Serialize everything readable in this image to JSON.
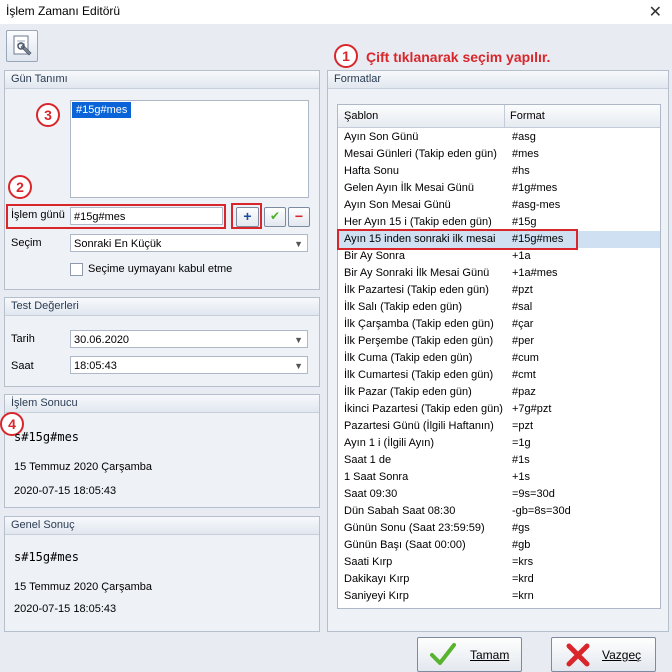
{
  "window": {
    "title": "İşlem Zamanı Editörü",
    "close_glyph": "✕"
  },
  "annotations": {
    "n1": "1",
    "n2": "2",
    "n3": "3",
    "n4": "4",
    "instruction": "Çift tıklanarak seçim yapılır."
  },
  "gun_tanimi": {
    "header": "Gün Tanımı",
    "list_items": [
      "#15g#mes"
    ],
    "islem_gunu_label": "İşlem günü",
    "islem_gunu_value": "#15g#mes",
    "secim_label": "Seçim",
    "secim_value": "Sonraki En Küçük",
    "checkbox_label": "Seçime uymayanı kabul etme",
    "add_glyph": "+",
    "apply_glyph": "✔",
    "remove_glyph": "−"
  },
  "test_degerleri": {
    "header": "Test Değerleri",
    "tarih_label": "Tarih",
    "tarih_value": "30.06.2020",
    "saat_label": "Saat",
    "saat_value": "18:05:43"
  },
  "islem_sonucu": {
    "header": "İşlem Sonucu",
    "expr": "s#15g#mes",
    "date_text": "15 Temmuz 2020 Çarşamba",
    "datetime": "2020-07-15 18:05:43"
  },
  "genel_sonuc": {
    "header": "Genel Sonuç",
    "expr": "s#15g#mes",
    "date_text": "15 Temmuz 2020 Çarşamba",
    "datetime": "2020-07-15 18:05:43"
  },
  "formatlar": {
    "header": "Formatlar",
    "col_sablon": "Şablon",
    "col_format": "Format",
    "rows": [
      {
        "sablon": "Ayın Son Günü",
        "format": "#asg"
      },
      {
        "sablon": "Mesai Günleri  (Takip eden gün)",
        "format": "#mes"
      },
      {
        "sablon": "Hafta Sonu",
        "format": "#hs"
      },
      {
        "sablon": "Gelen Ayın İlk Mesai Günü",
        "format": "#1g#mes"
      },
      {
        "sablon": "Ayın Son Mesai Günü",
        "format": "#asg-mes"
      },
      {
        "sablon": "Her Ayın 15 i  (Takip eden gün)",
        "format": "#15g"
      },
      {
        "sablon": "Ayın 15 inden sonraki ilk mesai",
        "format": "#15g#mes"
      },
      {
        "sablon": "Bir Ay Sonra",
        "format": "+1a"
      },
      {
        "sablon": "Bir Ay Sonraki İlk Mesai Günü",
        "format": "+1a#mes"
      },
      {
        "sablon": "İlk Pazartesi (Takip eden gün)",
        "format": "#pzt"
      },
      {
        "sablon": "İlk Salı (Takip eden gün)",
        "format": "#sal"
      },
      {
        "sablon": "İlk Çarşamba (Takip eden gün)",
        "format": "#çar"
      },
      {
        "sablon": "İlk Perşembe (Takip eden gün)",
        "format": "#per"
      },
      {
        "sablon": "İlk Cuma (Takip eden gün)",
        "format": "#cum"
      },
      {
        "sablon": "İlk Cumartesi (Takip eden gün)",
        "format": "#cmt"
      },
      {
        "sablon": "İlk Pazar (Takip eden gün)",
        "format": "#paz"
      },
      {
        "sablon": "İkinci Pazartesi (Takip eden gün)",
        "format": "+7g#pzt"
      },
      {
        "sablon": "Pazartesi Günü (İlgili Haftanın)",
        "format": "=pzt"
      },
      {
        "sablon": "Ayın 1 i (İlgili Ayın)",
        "format": "=1g"
      },
      {
        "sablon": "Saat 1 de",
        "format": "#1s"
      },
      {
        "sablon": "1 Saat Sonra",
        "format": "+1s"
      },
      {
        "sablon": "Saat 09:30",
        "format": "=9s=30d"
      },
      {
        "sablon": "Dün Sabah Saat 08:30",
        "format": "-gb=8s=30d"
      },
      {
        "sablon": "Günün Sonu (Saat 23:59:59)",
        "format": "#gs"
      },
      {
        "sablon": "Günün Başı (Saat 00:00)",
        "format": "#gb"
      },
      {
        "sablon": "Saati Kırp",
        "format": "=krs"
      },
      {
        "sablon": "Dakikayı Kırp",
        "format": "=krd"
      },
      {
        "sablon": "Saniyeyi Kırp",
        "format": "=krn"
      }
    ]
  },
  "buttons": {
    "ok": "Tamam",
    "cancel": "Vazgeç"
  },
  "colors": {
    "accent_red": "#d8262b",
    "selection": "#cfe0f2",
    "list_selected": "#0a64d8"
  }
}
